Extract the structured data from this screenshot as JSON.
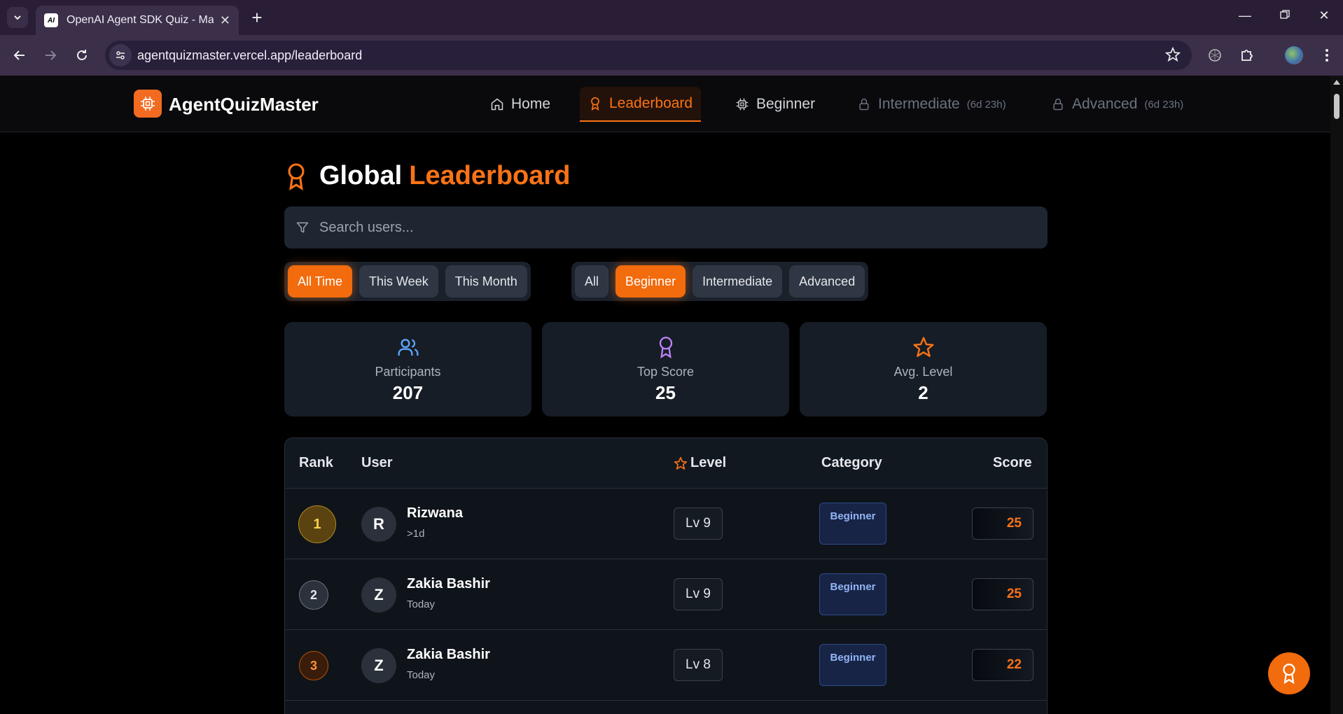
{
  "browser": {
    "tab_title": "OpenAI Agent SDK Quiz - Mastery",
    "favicon_text": "AI",
    "url": "agentquizmaster.vercel.app/leaderboard"
  },
  "header": {
    "logo_text": "AgentQuizMaster",
    "nav": {
      "home": "Home",
      "leaderboard": "Leaderboard",
      "beginner": "Beginner",
      "intermediate": "Intermediate",
      "intermediate_badge": "(6d 23h)",
      "advanced": "Advanced",
      "advanced_badge": "(6d 23h)"
    }
  },
  "page": {
    "title_part1": "Global",
    "title_part2": "Leaderboard",
    "search_placeholder": "Search users...",
    "time_filters": [
      "All Time",
      "This Week",
      "This Month"
    ],
    "time_filter_active": "All Time",
    "level_filters": [
      "All",
      "Beginner",
      "Intermediate",
      "Advanced"
    ],
    "level_filter_active": "Beginner"
  },
  "stats": {
    "participants_label": "Participants",
    "participants_value": "207",
    "top_score_label": "Top Score",
    "top_score_value": "25",
    "avg_level_label": "Avg. Level",
    "avg_level_value": "2"
  },
  "table": {
    "headers": {
      "rank": "Rank",
      "user": "User",
      "level": "Level",
      "category": "Category",
      "score": "Score"
    },
    "rows": [
      {
        "rank": "1",
        "initial": "R",
        "name": "Rizwana",
        "time": ">1d",
        "level": "Lv 9",
        "category": "Beginner",
        "score": "25"
      },
      {
        "rank": "2",
        "initial": "Z",
        "name": "Zakia Bashir",
        "time": "Today",
        "level": "Lv 9",
        "category": "Beginner",
        "score": "25"
      },
      {
        "rank": "3",
        "initial": "Z",
        "name": "Zakia Bashir",
        "time": "Today",
        "level": "Lv 8",
        "category": "Beginner",
        "score": "22"
      }
    ]
  },
  "colors": {
    "accent": "#f97316",
    "background": "#000000",
    "card": "#161d26"
  }
}
